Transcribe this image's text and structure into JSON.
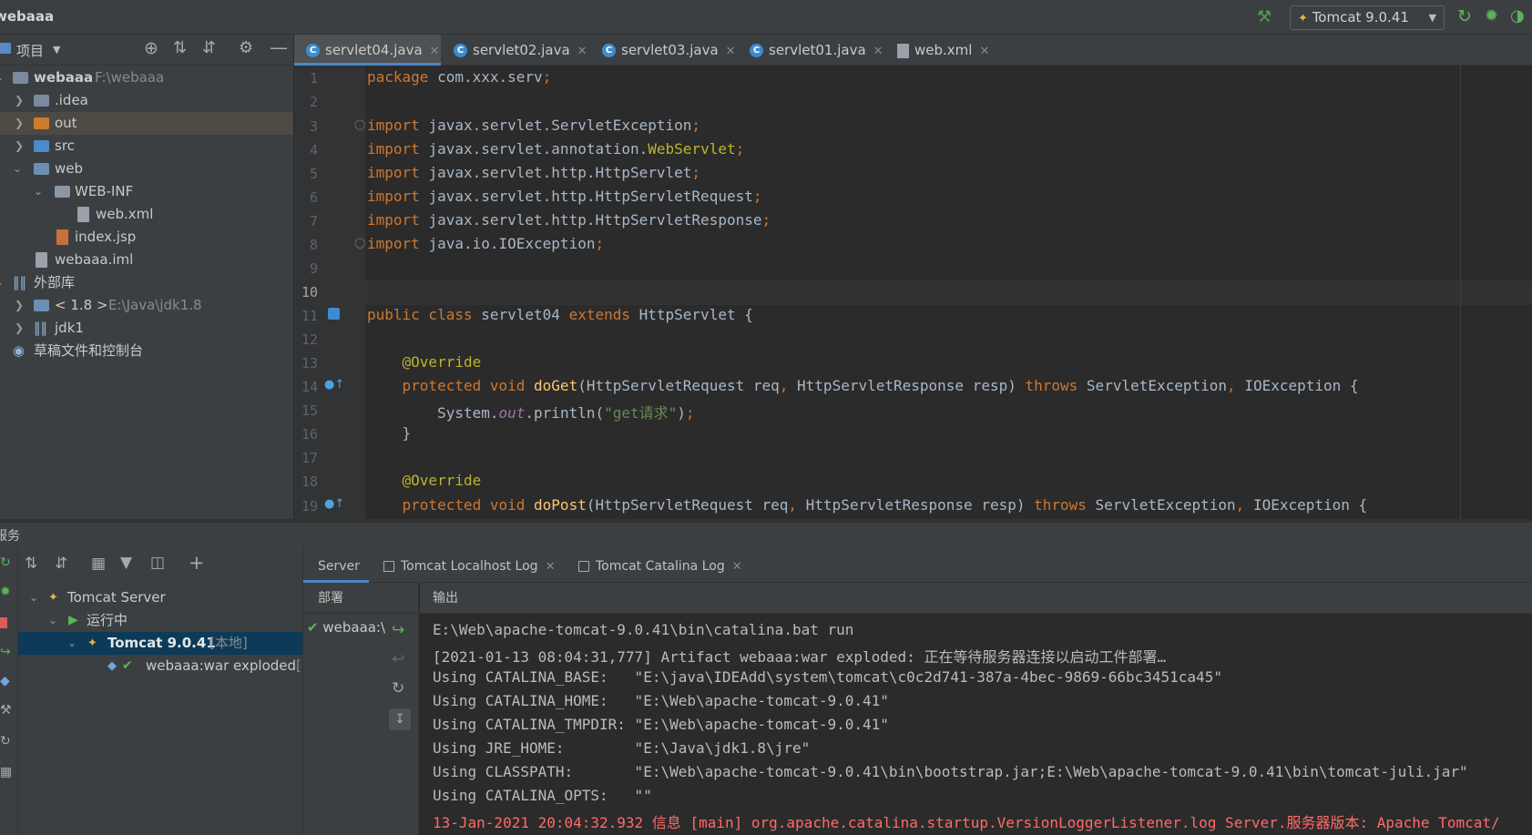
{
  "window": {
    "project_title": "webaaa"
  },
  "toolbar": {
    "run_config": "Tomcat 9.0.41"
  },
  "project_panel": {
    "title": "项目",
    "tree": [
      {
        "label": "webaaa",
        "path": "F:\\webaaa"
      },
      {
        "label": ".idea"
      },
      {
        "label": "out"
      },
      {
        "label": "src"
      },
      {
        "label": "web"
      },
      {
        "label": "WEB-INF"
      },
      {
        "label": "web.xml"
      },
      {
        "label": "index.jsp"
      },
      {
        "label": "webaaa.iml"
      },
      {
        "label": "外部库"
      },
      {
        "label": "< 1.8 >",
        "path": "E:\\Java\\jdk1.8"
      },
      {
        "label": "jdk1"
      },
      {
        "label": "草稿文件和控制台"
      }
    ]
  },
  "editor": {
    "tabs": [
      {
        "label": "servlet04.java",
        "active": true
      },
      {
        "label": "servlet02.java"
      },
      {
        "label": "servlet03.java"
      },
      {
        "label": "servlet01.java"
      },
      {
        "label": "web.xml"
      }
    ],
    "line_numbers": [
      "1",
      "2",
      "3",
      "4",
      "5",
      "6",
      "7",
      "8",
      "9",
      "10",
      "11",
      "12",
      "13",
      "14",
      "15",
      "16",
      "17",
      "18",
      "19"
    ],
    "current_line": "10"
  },
  "services": {
    "title": "服务",
    "tree": [
      {
        "label": "Tomcat Server"
      },
      {
        "label": "运行中"
      },
      {
        "label": "Tomcat 9.0.41",
        "suffix": "[本地]"
      },
      {
        "label": "webaaa:war exploded",
        "suffix": "[i"
      }
    ],
    "tabs": [
      {
        "label": "Server",
        "active": true
      },
      {
        "label": "Tomcat Localhost Log"
      },
      {
        "label": "Tomcat Catalina Log"
      }
    ],
    "deploy_header": "部署",
    "deploy_item": "webaaa:\\",
    "output_header": "输出",
    "output_lines": [
      {
        "text": "E:\\Web\\apache-tomcat-9.0.41\\bin\\catalina.bat run",
        "color": "#bbbbbb"
      },
      {
        "text": "[2021-01-13 08:04:31,777] Artifact webaaa:war exploded: 正在等待服务器连接以启动工件部署…",
        "color": "#bbbbbb"
      },
      {
        "text": "Using CATALINA_BASE:   \"E:\\java\\IDEAdd\\system\\tomcat\\c0c2d741-387a-4bec-9869-66bc3451ca45\"",
        "color": "#bbbbbb"
      },
      {
        "text": "Using CATALINA_HOME:   \"E:\\Web\\apache-tomcat-9.0.41\"",
        "color": "#bbbbbb"
      },
      {
        "text": "Using CATALINA_TMPDIR: \"E:\\Web\\apache-tomcat-9.0.41\"",
        "color": "#bbbbbb"
      },
      {
        "text": "Using JRE_HOME:        \"E:\\Java\\jdk1.8\\jre\"",
        "color": "#bbbbbb"
      },
      {
        "text": "Using CLASSPATH:       \"E:\\Web\\apache-tomcat-9.0.41\\bin\\bootstrap.jar;E:\\Web\\apache-tomcat-9.0.41\\bin\\tomcat-juli.jar\"",
        "color": "#bbbbbb"
      },
      {
        "text": "Using CATALINA_OPTS:   \"\"",
        "color": "#bbbbbb"
      },
      {
        "text": "13-Jan-2021 20:04:32.932 信息 [main] org.apache.catalina.startup.VersionLoggerListener.log Server.服务器版本: Apache Tomcat/",
        "color": "#ff6b68"
      }
    ]
  },
  "colors": {
    "background": "#2b2b2b",
    "panel": "#3c3f41",
    "keyword": "#cc7832",
    "annotation": "#bbb529",
    "string": "#6a8759",
    "method": "#ffc66d",
    "error_text": "#ff6b68",
    "accent": "#4a88c7"
  },
  "icons": [
    "hammer-icon",
    "tomcat-icon",
    "rerun-icon",
    "debug-icon",
    "coverage-icon",
    "locate-icon",
    "expand-all-icon",
    "collapse-all-icon",
    "gear-icon",
    "minimize-icon",
    "folder-icon",
    "java-class-icon",
    "xml-file-icon",
    "jsp-file-icon",
    "library-icon",
    "play-icon",
    "check-icon",
    "deploy-icon",
    "undeploy-icon",
    "refresh-icon",
    "filter-icon",
    "add-icon"
  ]
}
